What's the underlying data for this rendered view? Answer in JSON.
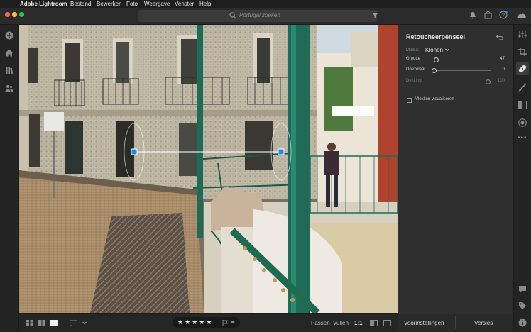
{
  "menubar": {
    "app_name": "Adobe Lightroom",
    "items": [
      "Bestand",
      "Bewerken",
      "Foto",
      "Weergave",
      "Venster",
      "Help"
    ]
  },
  "search": {
    "placeholder": "Portugal zoeken"
  },
  "panel": {
    "title": "Retoucheerpenseel",
    "mode_label": "Modus",
    "mode_value": "Klonen",
    "sliders": [
      {
        "label": "Grootte",
        "value": "47",
        "fraction": 0.0
      },
      {
        "label": "Doezelaar",
        "value": "0",
        "fraction": 0.0
      },
      {
        "label": "Dekking",
        "value": "100",
        "fraction": 1.0
      }
    ],
    "checkbox_label": "Vlekken visualiseren"
  },
  "bottombar": {
    "stars": [
      "★",
      "★",
      "★",
      "★",
      "★"
    ],
    "fit_label": "Passen",
    "fill_label": "Vullen",
    "ratio_label": "1:1"
  },
  "bottom_right": {
    "presets_label": "Voorinstellingen",
    "versions_label": "Versies"
  },
  "colors": {
    "accent": "#1e88e5",
    "panel_bg": "#2f2f2f",
    "app_bg": "#1b1b1b"
  },
  "icons": {
    "left": [
      "plus-icon",
      "home-icon",
      "library-icon",
      "people-icon"
    ],
    "right": [
      "adjust-icon",
      "crop-icon",
      "healing-icon",
      "brush-icon",
      "gradient-icon",
      "radial-icon",
      "more-icon",
      "comment-icon",
      "tag-icon",
      "info-icon"
    ]
  }
}
